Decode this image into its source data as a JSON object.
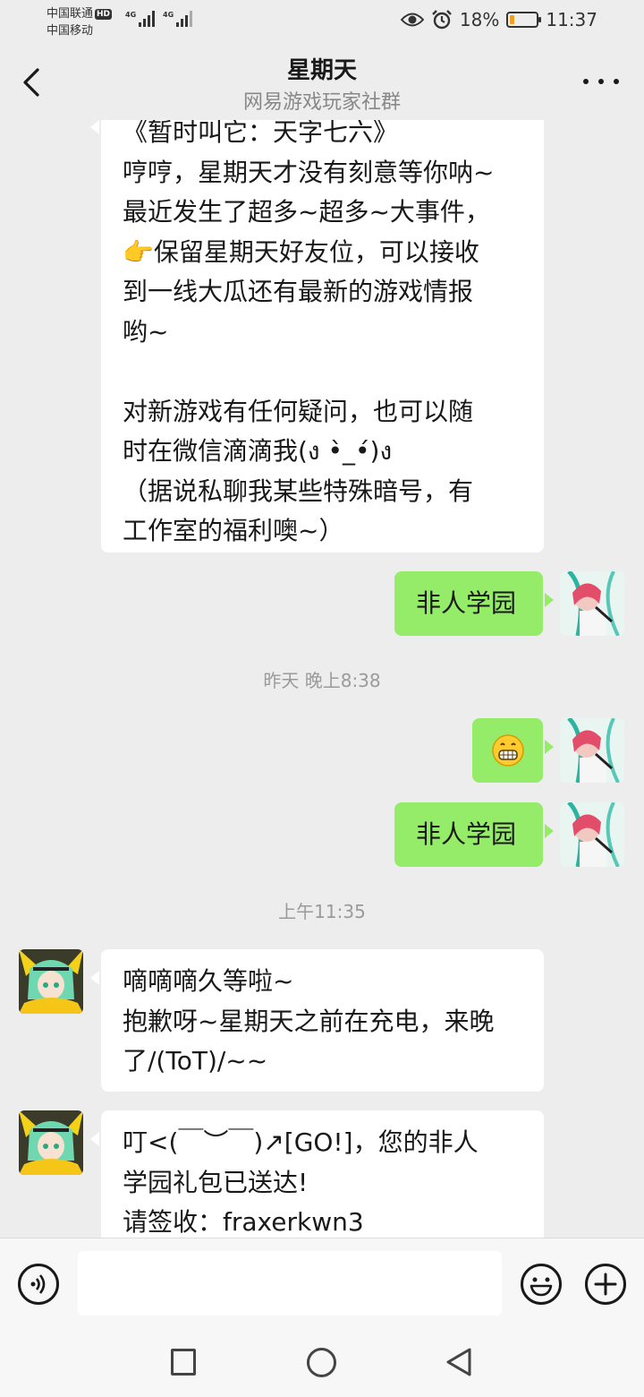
{
  "status_bar": {
    "carrier1": "中国联通",
    "carrier1_badge": "HD",
    "carrier2": "中国移动",
    "network1": "4G",
    "network2": "4G",
    "battery_percent": "18%",
    "battery_level": 0.18,
    "time": "11:37"
  },
  "header": {
    "title": "星期天",
    "subtitle": "网易游戏玩家社群"
  },
  "messages": {
    "m1": {
      "sender": "them",
      "lines": [
        "《暂时叫它：天字七六》",
        "哼哼，星期天才没有刻意等你呐~",
        "最近发生了超多~超多~大事件，",
        "👉保留星期天好友位，可以接收",
        "到一线大瓜还有最新的游戏情报",
        "哟~",
        "",
        "对新游戏有任何疑问，也可以随",
        "时在微信滴滴我(ง •̀_•́)ง",
        "（据说私聊我某些特殊暗号，有",
        "工作室的福利噢~）"
      ]
    },
    "m2": {
      "sender": "me",
      "text": "非人学园"
    },
    "ts1": "昨天 晚上8:38",
    "m3": {
      "sender": "me",
      "emoji": "grin-emoji"
    },
    "m4": {
      "sender": "me",
      "text": "非人学园"
    },
    "ts2": "上午11:35",
    "m5": {
      "sender": "them",
      "lines": [
        "嘀嘀嘀久等啦~",
        "抱歉呀~星期天之前在充电，来晚",
        "了/(ToT)/~~"
      ]
    },
    "m6": {
      "sender": "them",
      "lines": [
        "叮<(￣︶￣)↗[GO!]，您的非人",
        "学园礼包已送达!",
        "请签收：fraxerkwn3"
      ]
    }
  },
  "input": {
    "value": "",
    "placeholder": ""
  },
  "colors": {
    "background": "#ededed",
    "my_bubble": "#95ec69",
    "their_bubble": "#ffffff",
    "battery_low": "#f0a020"
  }
}
